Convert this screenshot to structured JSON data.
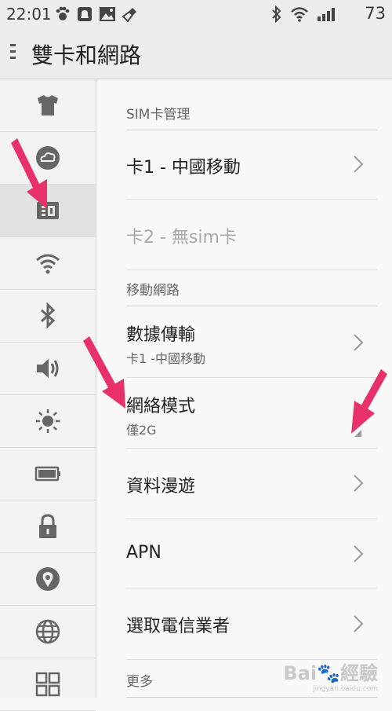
{
  "status_bar": {
    "time": "22:01",
    "battery": "73",
    "left_icons": [
      "paw-icon",
      "notification-icon",
      "image-icon",
      "broom-icon"
    ],
    "right_icons": [
      "bluetooth-icon",
      "wifi-icon",
      "signal-icon"
    ]
  },
  "header": {
    "title": "雙卡和網路"
  },
  "sidebar": {
    "items": [
      {
        "icon": "shirt-icon"
      },
      {
        "icon": "cloud-icon"
      },
      {
        "icon": "sim-card-icon",
        "active": true
      },
      {
        "icon": "wifi-icon"
      },
      {
        "icon": "bluetooth-icon"
      },
      {
        "icon": "speaker-icon"
      },
      {
        "icon": "brightness-icon"
      },
      {
        "icon": "battery-icon"
      },
      {
        "icon": "lock-icon"
      },
      {
        "icon": "location-icon"
      },
      {
        "icon": "globe-icon"
      },
      {
        "icon": "apps-grid-icon"
      }
    ]
  },
  "content": {
    "sim_section": "SIM卡管理",
    "sim1": "卡1 - 中國移動",
    "sim2": "卡2 - 無sim卡",
    "mobile_section": "移動網路",
    "data_title": "數據傳輸",
    "data_sub": "卡1 -中國移動",
    "mode_title": "網絡模式",
    "mode_sub": "僅2G",
    "roaming": "資料漫遊",
    "apn": "APN",
    "carrier": "選取電信業者",
    "more_section": "更多"
  },
  "watermark": {
    "text": "Bai",
    "text2": "經驗",
    "url": "jingyan.baidu.com"
  },
  "colors": {
    "annotation_arrow": "#e8306a",
    "background": "#f7f7f7"
  }
}
